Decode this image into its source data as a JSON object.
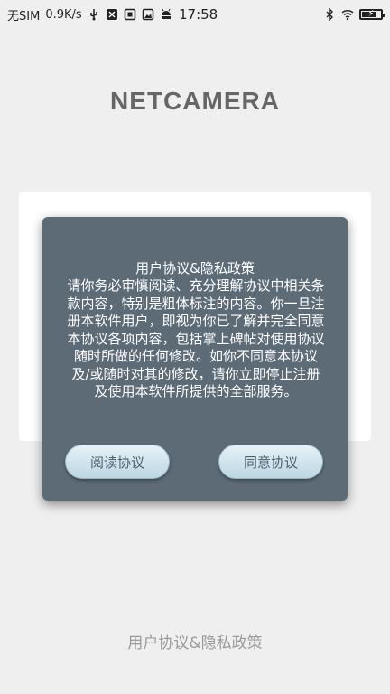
{
  "status_bar": {
    "carrier": "无SIM",
    "net_speed": "0.9K/s",
    "time": "17:58",
    "left_icons": [
      "usb-icon",
      "app-icon",
      "sim-icon",
      "gallery-icon",
      "android-icon"
    ],
    "right_icons": [
      "bluetooth-icon",
      "wifi-icon",
      "battery-charging-icon"
    ]
  },
  "app": {
    "title": "NETCAMERA",
    "bottom_link": "用户协议&隐私政策"
  },
  "dialog": {
    "title": "用户协议&隐私政策",
    "body": "请你务必审慎阅读、充分理解协议中相关条款内容，特别是粗体标注的内容。你一旦注册本软件用户，即视为你已了解并完全同意本协议各项内容，包括掌上碑帖对使用协议随时所做的任何修改。如你不同意本协议及/或随时对其的修改，请你立即停止注册及使用本软件所提供的全部服务。",
    "read_button": "阅读协议",
    "agree_button": "同意协议"
  },
  "colors": {
    "background": "#efefef",
    "dialog": "#5d6b77",
    "title_gray": "#666666",
    "button_text": "#4d6270"
  }
}
